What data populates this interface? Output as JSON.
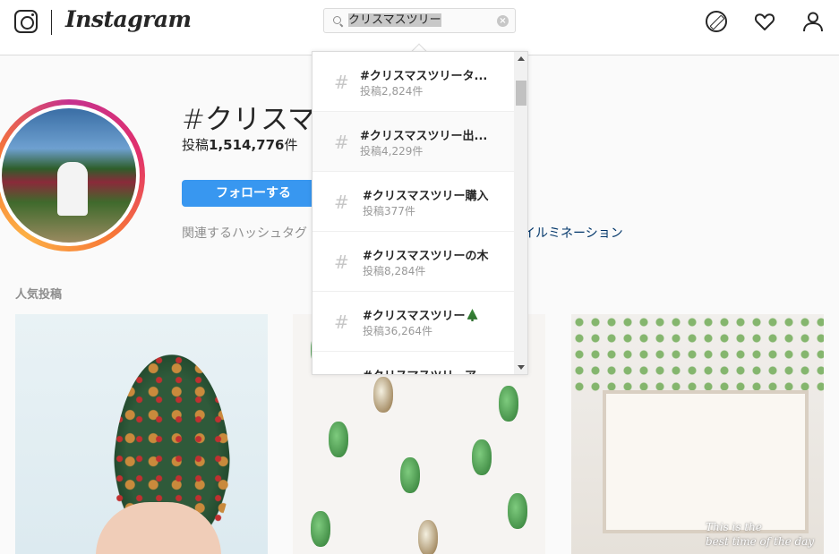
{
  "nav": {
    "wordmark": "Instagram",
    "search": {
      "value": "クリスマスツリー",
      "clear": "×"
    }
  },
  "header": {
    "title": "#クリスマスツリー",
    "posts_label": "投稿",
    "posts_count": "1,514,776",
    "posts_unit": "件",
    "follow_label": "フォローする",
    "related_label": "関連するハッシュタグ",
    "related_tag": "イルミネーション"
  },
  "section": {
    "top_posts": "人気投稿"
  },
  "dropdown": {
    "hash": "#",
    "results": [
      {
        "name": "#クリスマスツリータ...",
        "count": "投稿2,824件"
      },
      {
        "name": "#クリスマスツリー出...",
        "count": "投稿4,229件"
      },
      {
        "name": "#クリスマスツリー購入",
        "count": "投稿377件"
      },
      {
        "name": "#クリスマスツリーの木",
        "count": "投稿8,284件"
      },
      {
        "name": "#クリスマスツリー",
        "count": "投稿36,264件",
        "emoji": "tree-emoji"
      },
      {
        "name": "#クリスマスツリーア",
        "count": ""
      }
    ]
  },
  "photos": {
    "caption_line1": "This is the",
    "caption_line2": "best time of the day"
  },
  "colors": {
    "accent": "#3897f0",
    "link": "#003569",
    "muted": "#8e8e8e"
  }
}
